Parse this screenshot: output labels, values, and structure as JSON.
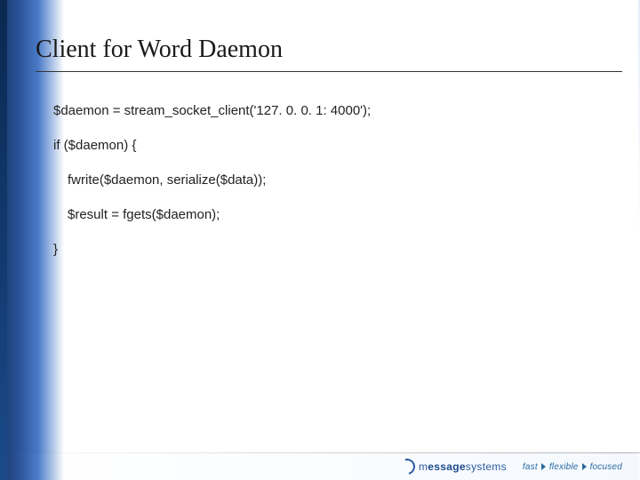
{
  "title": "Client for Word Daemon",
  "code": {
    "l1": "$daemon = stream_socket_client('127. 0. 0. 1: 4000');",
    "l2": "if ($daemon) {",
    "l3": "fwrite($daemon, serialize($data));",
    "l4": "$result = fgets($daemon);",
    "l5": "}"
  },
  "footer": {
    "logo_text_light": "m",
    "logo_text_bold": "essage",
    "logo_text_tail": "systems",
    "tag1": "fast",
    "tag2": "flexible",
    "tag3": "focused"
  }
}
